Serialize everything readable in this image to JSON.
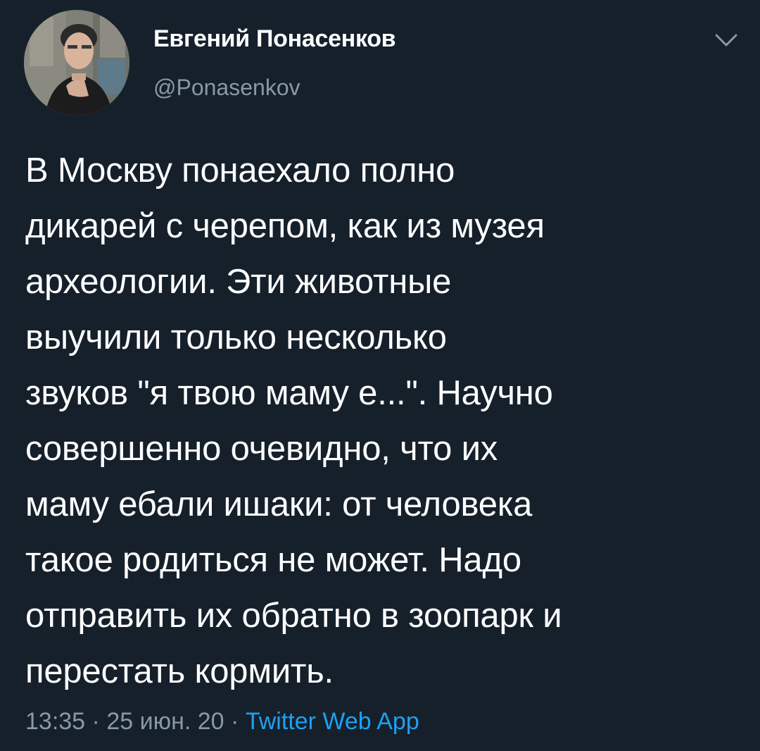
{
  "author": {
    "display_name": "Евгений Понасенков",
    "handle": "@Ponasenkov",
    "avatar_icon": "profile-photo"
  },
  "menu": {
    "icon": "chevron-down-icon"
  },
  "tweet": {
    "lines": [
      "В Москву понаехало полно",
      "дикарей с черепом, как из музея",
      "археологии. Эти животные",
      "выучили только несколько",
      "звуков \"я твою маму е...\". Научно",
      "совершенно очевидно, что их",
      "маму ебали ишаки: от человека",
      "такое родиться не может. Надо",
      "отправить их обратно в зоопарк и",
      "перестать кормить."
    ]
  },
  "meta": {
    "time": "13:35",
    "separator": "·",
    "date": "25 июн. 20",
    "source": "Twitter Web App"
  },
  "colors": {
    "background": "#15202b",
    "primary_text": "#ffffff",
    "secondary_text": "#8899a6",
    "link": "#1da1f2"
  }
}
